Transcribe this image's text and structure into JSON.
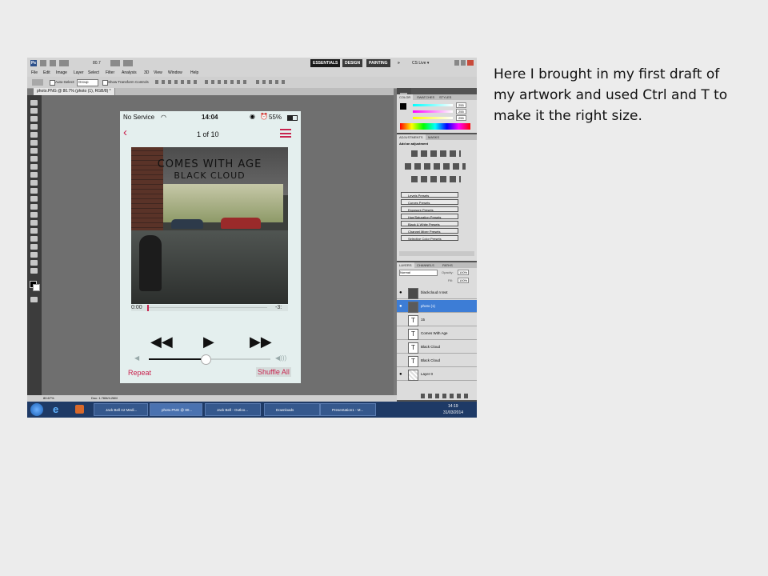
{
  "caption": "Here I brought in my first draft of my artwork and used Ctrl and T to make it the right size.",
  "photoshop": {
    "zoom_display": "80.7",
    "workspaces": [
      "ESSENTIALS",
      "DESIGN",
      "PAINTING",
      "»",
      "CS Live ▾"
    ],
    "menus": [
      "File",
      "Edit",
      "Image",
      "Layer",
      "Select",
      "Filter",
      "Analysis",
      "3D",
      "View",
      "Window",
      "Help"
    ],
    "options": {
      "auto_select": "Auto-Select:",
      "group": "Group",
      "transform": "Show Transform Controls"
    },
    "doc_tab": "photo.PNG @ 80.7% (photo (1), RGB/8) *",
    "color_tabs": [
      "COLOR",
      "SWATCHES",
      "STYLES"
    ],
    "rgb_values": [
      "255",
      "255",
      "255"
    ],
    "adjust_tabs": [
      "ADJUSTMENTS",
      "MASKS"
    ],
    "add_adjustment": "Add an adjustment",
    "presets": [
      "Levels Presets",
      "Curves Presets",
      "Exposure Presets",
      "Hue/Saturation Presets",
      "Black & White Presets",
      "Channel Mixer Presets",
      "Selective Color Presets"
    ],
    "layer_tabs": [
      "LAYERS",
      "CHANNELS",
      "PATHS"
    ],
    "blend_mode": "Normal",
    "opacity_label": "Opacity:",
    "opacity": "100%",
    "fill_label": "Fill:",
    "fill": "100%",
    "layers": [
      {
        "name": "blackcloud n text",
        "thumb": "img"
      },
      {
        "name": "photo (1)",
        "thumb": "img",
        "selected": true
      },
      {
        "name": "15",
        "thumb": "T"
      },
      {
        "name": "Comes With Age",
        "thumb": "T"
      },
      {
        "name": "Black Cloud",
        "thumb": "T"
      },
      {
        "name": "Black Cloud",
        "thumb": "T"
      },
      {
        "name": "Layer 0",
        "thumb": "img"
      }
    ],
    "status_zoom": "80.67%",
    "doc_size": "Doc: 1.76M/4.26M"
  },
  "phone": {
    "carrier": "No Service",
    "time": "14:04",
    "battery": "55%",
    "track_position": "1 of 10",
    "art_title_1": "COMES WITH AGE",
    "art_title_2": "BLACK CLOUD",
    "elapsed": "0:00",
    "remaining": "-3:",
    "repeat": "Repeat",
    "shuffle": "Shuffle All",
    "volume_level": 0.47
  },
  "taskbar": {
    "items": [
      "Jack Bell A2 Medi...",
      "photo.PNG @ 80...",
      "Jack Bell - Outloo...",
      "Downloads",
      "Presentation1 - M..."
    ],
    "time": "14:19",
    "date": "31/03/2014"
  },
  "colors": {
    "accent": "#c8234e",
    "selection": "#3d7dd6",
    "taskbar": "#1e3a66"
  }
}
